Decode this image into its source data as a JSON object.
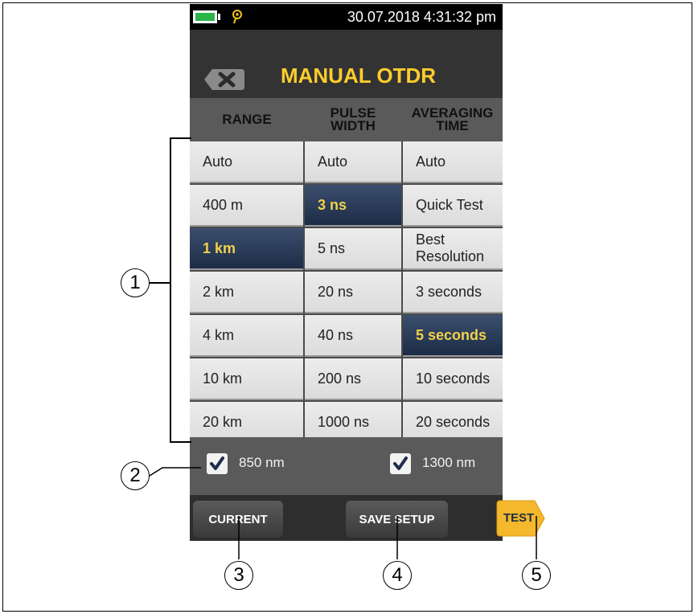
{
  "status": {
    "datetime": "30.07.2018 4:31:32 pm",
    "battery_icon": "battery-icon",
    "location_icon": "location-pin-icon"
  },
  "header": {
    "title": "MANUAL OTDR",
    "back_icon": "close-x-icon"
  },
  "columns": {
    "range": "RANGE",
    "pulse_width_line1": "PULSE",
    "pulse_width_line2": "WIDTH",
    "averaging_time": "AVERAGING TIME"
  },
  "range_options": [
    "Auto",
    "400 m",
    "1 km",
    "2 km",
    "4 km",
    "10 km",
    "20 km"
  ],
  "range_selected": "1 km",
  "pulse_options": [
    "Auto",
    "3 ns",
    "5 ns",
    "20 ns",
    "40 ns",
    "200 ns",
    "1000 ns"
  ],
  "pulse_selected": "3 ns",
  "averaging_options": [
    "Auto",
    "Quick Test",
    "Best Resolution",
    "3 seconds",
    "5 seconds",
    "10 seconds",
    "20 seconds"
  ],
  "averaging_selected": "5 seconds",
  "wavelengths": [
    {
      "label": "850 nm",
      "checked": true
    },
    {
      "label": "1300 nm",
      "checked": true
    }
  ],
  "buttons": {
    "current": "CURRENT",
    "save_setup": "SAVE SETUP",
    "test": "TEST"
  },
  "callouts": [
    "1",
    "2",
    "3",
    "4",
    "5"
  ],
  "colors": {
    "accent": "#ffcd2c",
    "selected_bg": "#1c2c46",
    "selected_text": "#f1d14b",
    "battery": "#2bb44a"
  }
}
